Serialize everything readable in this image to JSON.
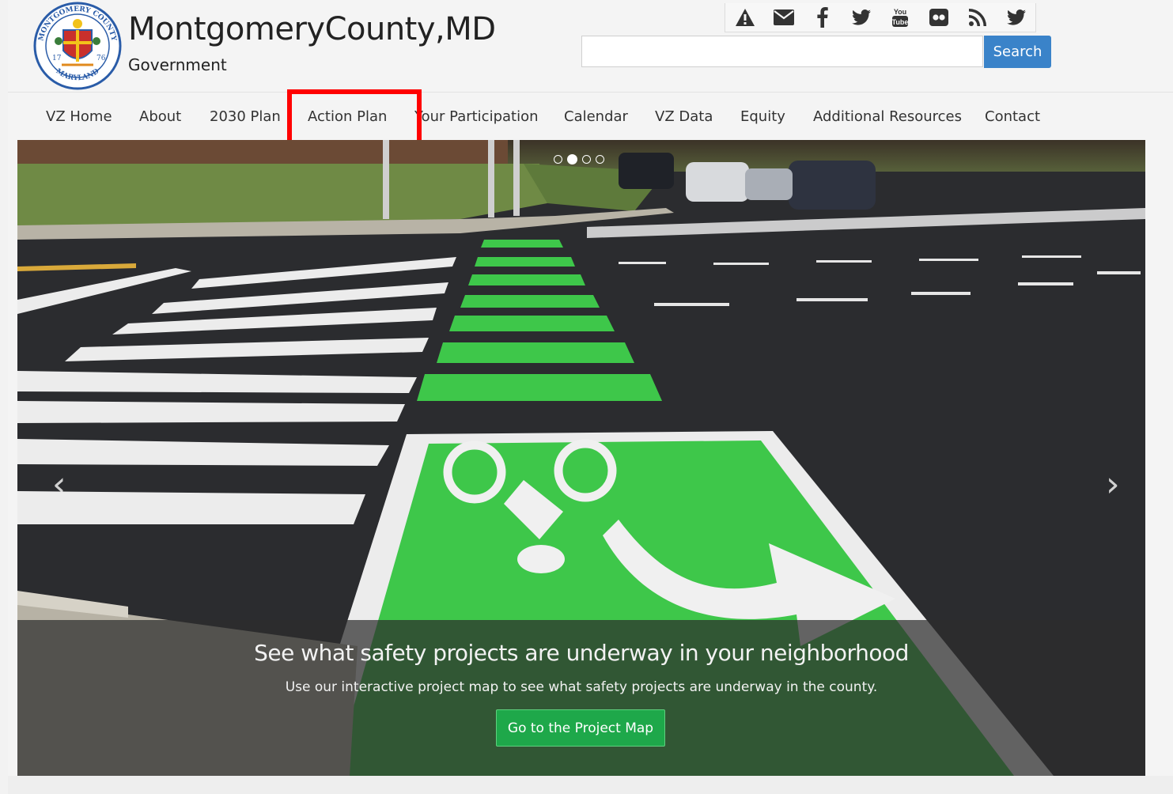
{
  "brand": {
    "title": "MontgomeryCounty,MD",
    "subtitle": "Government",
    "seal_text_top": "MONTGOMERY COUNTY",
    "seal_text_bottom": "MARYLAND",
    "seal_year_left": "17",
    "seal_year_right": "76"
  },
  "social_icons": [
    "alert-icon",
    "email-icon",
    "facebook-icon",
    "twitter-icon",
    "youtube-icon",
    "flickr-icon",
    "rss-icon",
    "twitter-icon"
  ],
  "social_youtube_label": "You Tube",
  "search": {
    "placeholder": "",
    "value": "",
    "button_label": "Search"
  },
  "nav": {
    "items": [
      "VZ Home",
      "About",
      "2030 Plan",
      "Action Plan",
      "Your Participation",
      "Calendar",
      "VZ Data",
      "Equity",
      "Additional Resources",
      "Contact"
    ],
    "highlighted": "Action Plan"
  },
  "carousel": {
    "slide_count": 4,
    "active_index": 1,
    "prev_arrow": "‹",
    "next_arrow": "›",
    "caption_title": "See what safety projects are underway in your neighborhood",
    "caption_text": "Use our interactive project map to see what safety projects are underway in the county.",
    "button_label": "Go to the Project Map"
  },
  "colors": {
    "accent_blue": "#3a83c9",
    "button_green": "#1ea84a",
    "highlight_red": "#ff0000",
    "bike_green": "#3ec74a"
  }
}
